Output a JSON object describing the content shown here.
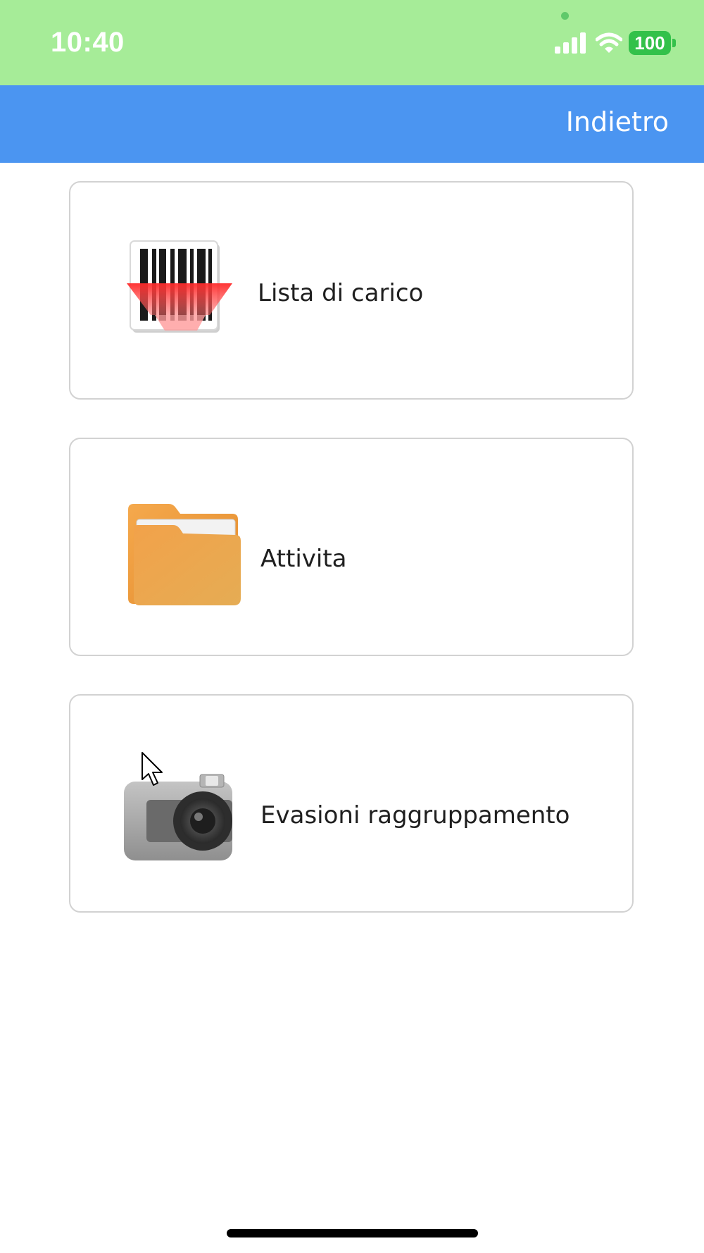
{
  "status_bar": {
    "time": "10:40",
    "battery_level": "100",
    "icons": [
      "signal-icon",
      "wifi-icon",
      "battery-icon"
    ],
    "background_color": "#a6ec98"
  },
  "nav_bar": {
    "back_label": "Indietro",
    "background_color": "#4b95f1"
  },
  "menu": {
    "items": [
      {
        "label": "Lista di carico",
        "icon": "barcode-scanner-icon"
      },
      {
        "label": "Attivita",
        "icon": "folder-icon"
      },
      {
        "label": "Evasioni raggruppamento",
        "icon": "camera-icon"
      }
    ]
  }
}
